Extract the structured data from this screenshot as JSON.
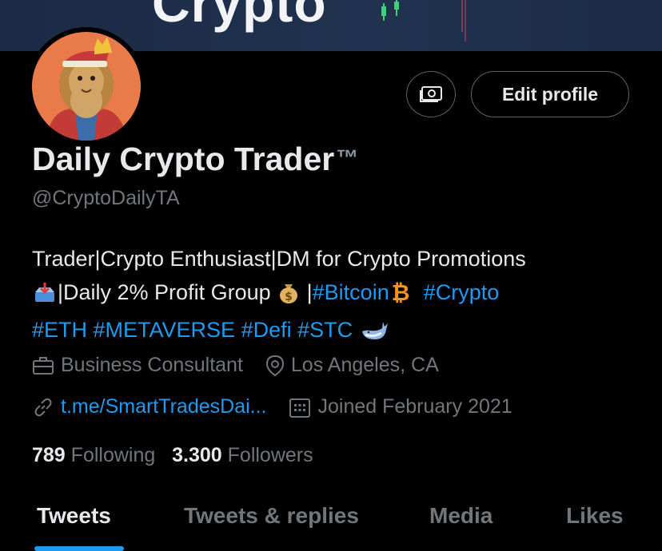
{
  "banner": {
    "text": "Crypto"
  },
  "profile": {
    "name": "Daily Crypto Trader",
    "trademark": "™",
    "handle": "@CryptoDailyTA",
    "edit_label": "Edit profile",
    "bio": {
      "line1": "Trader|Crypto Enthusiast|DM for Crypto Promotions",
      "line2_a": "|Daily 2% Profit Group",
      "line2_sep": " |",
      "tag_bitcoin": "#Bitcoin",
      "tag_crypto": "#Crypto",
      "line3_tags": "#ETH #METAVERSE #Defi #STC"
    },
    "occupation": "Business Consultant",
    "location": "Los Angeles, CA",
    "website": "t.me/SmartTradesDai...",
    "joined": "Joined February 2021",
    "following_count": "789",
    "following_label": "Following",
    "followers_count": "3.300",
    "followers_label": "Followers"
  },
  "tabs": [
    {
      "label": "Tweets",
      "active": true
    },
    {
      "label": "Tweets & replies",
      "active": false
    },
    {
      "label": "Media",
      "active": false
    },
    {
      "label": "Likes",
      "active": false
    }
  ],
  "colors": {
    "accent": "#1d9bf0",
    "muted": "#71767b",
    "text": "#e7e9ea",
    "background": "#000000"
  },
  "icons": [
    "tip-jar-icon",
    "briefcase-icon",
    "location-pin-icon",
    "link-icon",
    "calendar-icon",
    "inbox-tray-icon",
    "money-bag-icon",
    "bitcoin-icon",
    "whale-icon"
  ]
}
